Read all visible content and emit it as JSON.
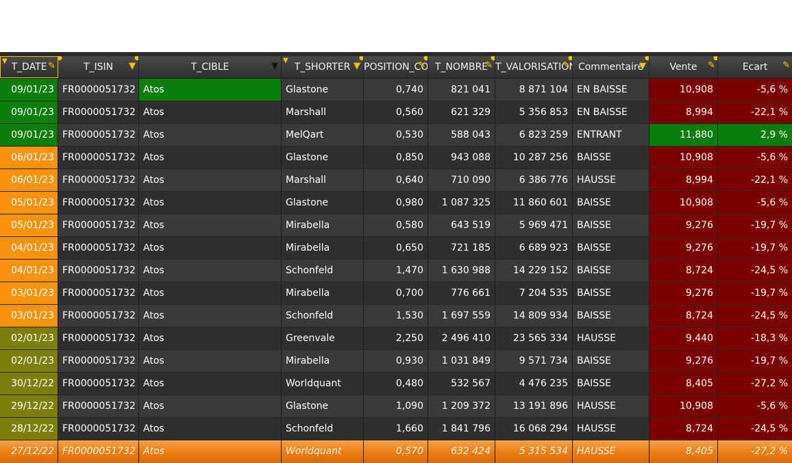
{
  "columns": [
    {
      "key": "date",
      "label": "T_DATE",
      "width": 85
    },
    {
      "key": "isin",
      "label": "T_ISIN",
      "width": 118
    },
    {
      "key": "cible",
      "label": "T_CIBLE",
      "width": 208
    },
    {
      "key": "shorter",
      "label": "T_SHORTER",
      "width": 120
    },
    {
      "key": "position",
      "label": "POSITION_COU",
      "width": 94
    },
    {
      "key": "nombre",
      "label": "T_NOMBRE",
      "width": 98
    },
    {
      "key": "valorisation",
      "label": "T_VALORISATION",
      "width": 113
    },
    {
      "key": "commentaire",
      "label": "Commentaire",
      "width": 112
    },
    {
      "key": "vente",
      "label": "Vente",
      "width": 100
    },
    {
      "key": "ecart",
      "label": "Ecart",
      "width": 108
    }
  ],
  "colors": {
    "green": "#0b7d0b",
    "orange": "#f7930f",
    "olive": "#7c7f0a",
    "red": "#7d0000",
    "highlight_row": "#ea7c12",
    "header_icon": "#f5c400"
  },
  "rows": [
    {
      "date": "09/01/23",
      "isin": "FR0000051732",
      "cible": "Atos",
      "shorter": "Glastone",
      "position": "0,740",
      "nombre": "821 041",
      "valorisation": "8 871 104",
      "commentaire": "EN BAISSE",
      "vente": "10,908",
      "ecart": "-5,6 %",
      "date_color": "green",
      "cible_color": "green",
      "vente_color": "red",
      "ecart_color": "red"
    },
    {
      "date": "09/01/23",
      "isin": "FR0000051732",
      "cible": "Atos",
      "shorter": "Marshall",
      "position": "0,560",
      "nombre": "621 329",
      "valorisation": "5 356 853",
      "commentaire": "EN BAISSE",
      "vente": "8,994",
      "ecart": "-22,1 %",
      "date_color": "green",
      "vente_color": "red",
      "ecart_color": "red"
    },
    {
      "date": "09/01/23",
      "isin": "FR0000051732",
      "cible": "Atos",
      "shorter": "MelQart",
      "position": "0,530",
      "nombre": "588 043",
      "valorisation": "6 823 259",
      "commentaire": "ENTRANT",
      "vente": "11,880",
      "ecart": "2,9 %",
      "date_color": "green",
      "vente_color": "green",
      "ecart_color": "green"
    },
    {
      "date": "06/01/23",
      "isin": "FR0000051732",
      "cible": "Atos",
      "shorter": "Glastone",
      "position": "0,850",
      "nombre": "943 088",
      "valorisation": "10 287 256",
      "commentaire": "BAISSE",
      "vente": "10,908",
      "ecart": "-5,6 %",
      "date_color": "orange",
      "vente_color": "red",
      "ecart_color": "red"
    },
    {
      "date": "06/01/23",
      "isin": "FR0000051732",
      "cible": "Atos",
      "shorter": "Marshall",
      "position": "0,640",
      "nombre": "710 090",
      "valorisation": "6 386 776",
      "commentaire": "HAUSSE",
      "vente": "8,994",
      "ecart": "-22,1 %",
      "date_color": "orange",
      "vente_color": "red",
      "ecart_color": "red"
    },
    {
      "date": "05/01/23",
      "isin": "FR0000051732",
      "cible": "Atos",
      "shorter": "Glastone",
      "position": "0,980",
      "nombre": "1 087 325",
      "valorisation": "11 860 601",
      "commentaire": "BAISSE",
      "vente": "10,908",
      "ecart": "-5,6 %",
      "date_color": "orange",
      "vente_color": "red",
      "ecart_color": "red"
    },
    {
      "date": "05/01/23",
      "isin": "FR0000051732",
      "cible": "Atos",
      "shorter": "Mirabella",
      "position": "0,580",
      "nombre": "643 519",
      "valorisation": "5 969 471",
      "commentaire": "BAISSE",
      "vente": "9,276",
      "ecart": "-19,7 %",
      "date_color": "orange",
      "vente_color": "red",
      "ecart_color": "red"
    },
    {
      "date": "04/01/23",
      "isin": "FR0000051732",
      "cible": "Atos",
      "shorter": "Mirabella",
      "position": "0,650",
      "nombre": "721 185",
      "valorisation": "6 689 923",
      "commentaire": "BAISSE",
      "vente": "9,276",
      "ecart": "-19,7 %",
      "date_color": "orange",
      "vente_color": "red",
      "ecart_color": "red"
    },
    {
      "date": "04/01/23",
      "isin": "FR0000051732",
      "cible": "Atos",
      "shorter": "Schonfeld",
      "position": "1,470",
      "nombre": "1 630 988",
      "valorisation": "14 229 152",
      "commentaire": "BAISSE",
      "vente": "8,724",
      "ecart": "-24,5 %",
      "date_color": "orange",
      "vente_color": "red",
      "ecart_color": "red"
    },
    {
      "date": "03/01/23",
      "isin": "FR0000051732",
      "cible": "Atos",
      "shorter": "Mirabella",
      "position": "0,700",
      "nombre": "776 661",
      "valorisation": "7 204 535",
      "commentaire": "BAISSE",
      "vente": "9,276",
      "ecart": "-19,7 %",
      "date_color": "orange",
      "vente_color": "red",
      "ecart_color": "red"
    },
    {
      "date": "03/01/23",
      "isin": "FR0000051732",
      "cible": "Atos",
      "shorter": "Schonfeld",
      "position": "1,530",
      "nombre": "1 697 559",
      "valorisation": "14 809 934",
      "commentaire": "BAISSE",
      "vente": "8,724",
      "ecart": "-24,5 %",
      "date_color": "orange",
      "vente_color": "red",
      "ecart_color": "red"
    },
    {
      "date": "02/01/23",
      "isin": "FR0000051732",
      "cible": "Atos",
      "shorter": "Greenvale",
      "position": "2,250",
      "nombre": "2 496 410",
      "valorisation": "23 565 334",
      "commentaire": "HAUSSE",
      "vente": "9,440",
      "ecart": "-18,3 %",
      "date_color": "olive",
      "vente_color": "red",
      "ecart_color": "red"
    },
    {
      "date": "02/01/23",
      "isin": "FR0000051732",
      "cible": "Atos",
      "shorter": "Mirabella",
      "position": "0,930",
      "nombre": "1 031 849",
      "valorisation": "9 571 734",
      "commentaire": "BAISSE",
      "vente": "9,276",
      "ecart": "-19,7 %",
      "date_color": "olive",
      "vente_color": "red",
      "ecart_color": "red"
    },
    {
      "date": "30/12/22",
      "isin": "FR0000051732",
      "cible": "Atos",
      "shorter": "Worldquant",
      "position": "0,480",
      "nombre": "532 567",
      "valorisation": "4 476 235",
      "commentaire": "BAISSE",
      "vente": "8,405",
      "ecart": "-27,2 %",
      "date_color": "olive",
      "vente_color": "red",
      "ecart_color": "red"
    },
    {
      "date": "29/12/22",
      "isin": "FR0000051732",
      "cible": "Atos",
      "shorter": "Glastone",
      "position": "1,090",
      "nombre": "1 209 372",
      "valorisation": "13 191 896",
      "commentaire": "HAUSSE",
      "vente": "10,908",
      "ecart": "-5,6 %",
      "date_color": "olive",
      "vente_color": "red",
      "ecart_color": "red"
    },
    {
      "date": "28/12/22",
      "isin": "FR0000051732",
      "cible": "Atos",
      "shorter": "Schonfeld",
      "position": "1,660",
      "nombre": "1 841 796",
      "valorisation": "16 068 294",
      "commentaire": "HAUSSE",
      "vente": "8,724",
      "ecart": "-24,5 %",
      "date_color": "olive",
      "vente_color": "red",
      "ecart_color": "red"
    },
    {
      "date": "27/12/22",
      "isin": "FR0000051732",
      "cible": "Atos",
      "shorter": "Worldquant",
      "position": "0,570",
      "nombre": "632 424",
      "valorisation": "5 315 534",
      "commentaire": "HAUSSE",
      "vente": "8,405",
      "ecart": "-27,2 %",
      "selected": true
    }
  ]
}
